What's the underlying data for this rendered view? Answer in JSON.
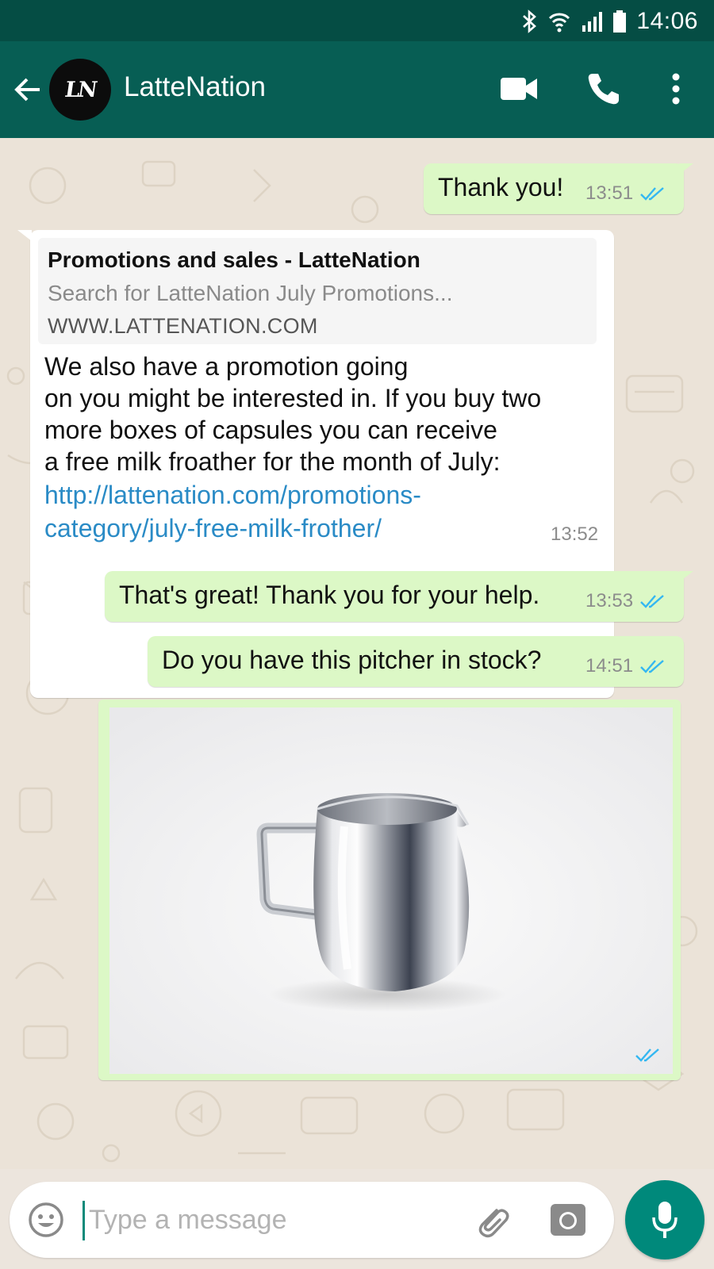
{
  "status_bar": {
    "time": "14:06",
    "icons": [
      "bluetooth-icon",
      "wifi-icon",
      "signal-icon",
      "battery-icon"
    ]
  },
  "header": {
    "avatar_monogram": "LN",
    "contact_name": "LatteNation",
    "actions": [
      "video-call-icon",
      "voice-call-icon",
      "more-options-icon"
    ]
  },
  "messages": [
    {
      "direction": "outgoing",
      "text": "Thank you!",
      "time": "13:51",
      "status": "read"
    },
    {
      "direction": "incoming",
      "link_preview": {
        "title": "Promotions and sales - LatteNation",
        "description": "Search for LatteNation July Promotions...",
        "domain": "WWW.LATTENATION.COM"
      },
      "text_lines": [
        "We also have a promotion going",
        "on you might be interested in. If you buy two",
        "more boxes of capsules you can receive",
        "a free milk froather for the month of July:"
      ],
      "link_lines": [
        "http://lattenation.com/promotions-",
        "category/july-free-milk-frother/"
      ],
      "time": "13:52"
    },
    {
      "direction": "outgoing",
      "text": "That's great! Thank you for your help.",
      "time": "13:53",
      "status": "read"
    },
    {
      "direction": "outgoing",
      "text": "Do you have this pitcher in stock?",
      "time": "14:51",
      "status": "read"
    },
    {
      "direction": "outgoing",
      "type": "image",
      "image_subject": "stainless steel milk pitcher",
      "status": "read"
    }
  ],
  "composer": {
    "placeholder": "Type a message",
    "icons": [
      "emoji-icon",
      "attach-icon",
      "camera-icon",
      "mic-icon"
    ]
  },
  "colors": {
    "status_bar": "#054d44",
    "header": "#075e54",
    "outgoing_bubble": "#dcf8c6",
    "incoming_bubble": "#ffffff",
    "read_ticks": "#34b7f1",
    "link": "#2a8bc6",
    "mic_button": "#00897b"
  }
}
